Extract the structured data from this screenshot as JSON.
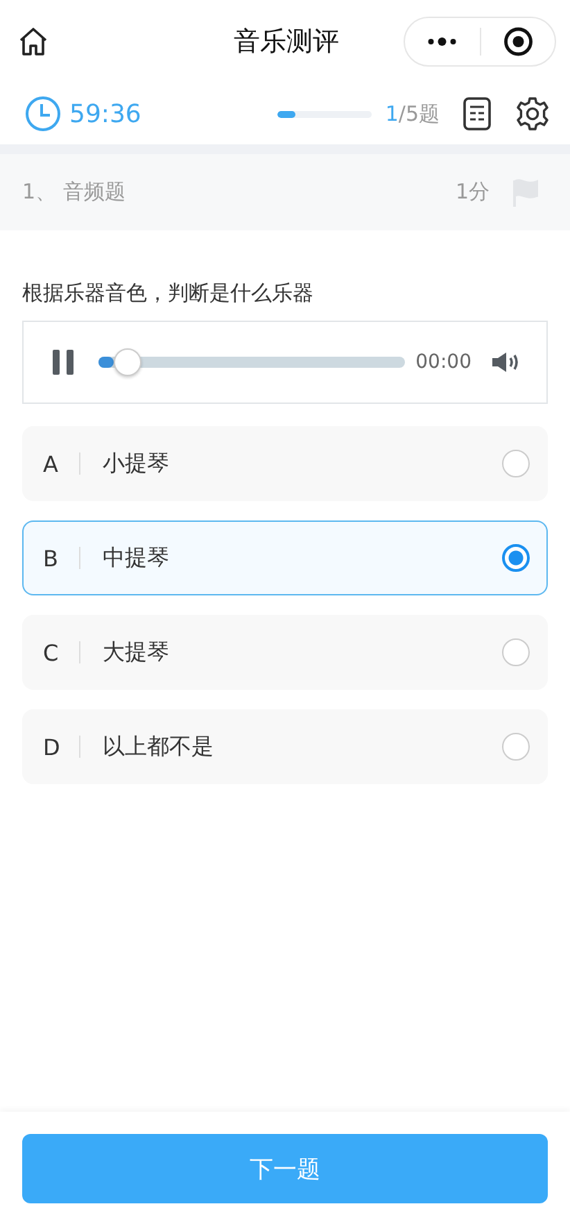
{
  "nav": {
    "title": "音乐测评"
  },
  "toolbar": {
    "timer": "59:36",
    "progress": {
      "level": 0.2,
      "current": "1",
      "total": "/5题"
    }
  },
  "section": {
    "label": "1、 音频题",
    "score": "1分",
    "flagged": false
  },
  "question": "根据乐器音色，判断是什么乐器",
  "audio": {
    "playing": true,
    "level": 0.09,
    "time": "00:00"
  },
  "options": [
    {
      "letter": "A",
      "text": "小提琴",
      "selected": false
    },
    {
      "letter": "B",
      "text": "中提琴",
      "selected": true
    },
    {
      "letter": "C",
      "text": "大提琴",
      "selected": false
    },
    {
      "letter": "D",
      "text": "以上都不是",
      "selected": false
    }
  ],
  "next_button": "下一题"
}
